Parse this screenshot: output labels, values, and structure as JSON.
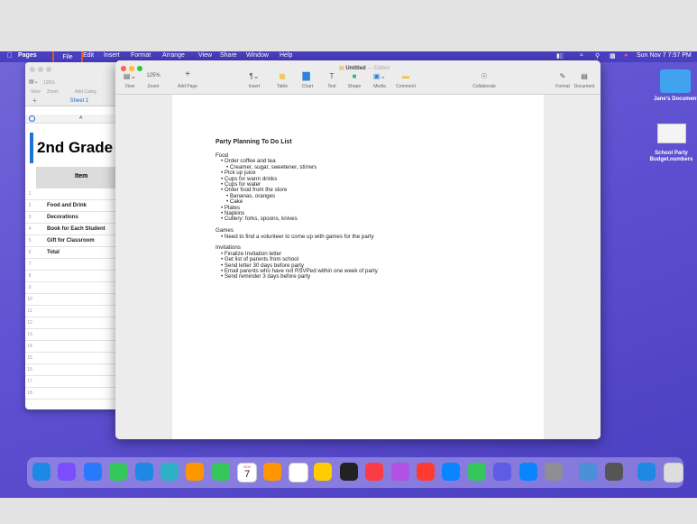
{
  "menubar": {
    "apple": "",
    "app": "Pages",
    "items": [
      "File",
      "Edit",
      "Insert",
      "Format",
      "Arrange",
      "View",
      "Share",
      "Window",
      "Help"
    ],
    "clock": "Sun Nov 7  7:57 PM"
  },
  "numbers_window": {
    "zoom": "125%",
    "toolbar_labels": [
      "View",
      "Zoom",
      "Add Categ"
    ],
    "sheet_tab": "Sheet 1",
    "column": "A",
    "title": "2nd Grade",
    "header": "Item",
    "rows": [
      {
        "num": "1",
        "text": ""
      },
      {
        "num": "2",
        "text": "Food  and Drink"
      },
      {
        "num": "3",
        "text": "Decorations"
      },
      {
        "num": "4",
        "text": "Book for Each Student"
      },
      {
        "num": "5",
        "text": "Gift for Classroom"
      },
      {
        "num": "6",
        "text": "Total"
      },
      {
        "num": "7",
        "text": ""
      },
      {
        "num": "8",
        "text": ""
      },
      {
        "num": "9",
        "text": ""
      },
      {
        "num": "10",
        "text": ""
      },
      {
        "num": "11",
        "text": ""
      },
      {
        "num": "12",
        "text": ""
      },
      {
        "num": "13",
        "text": ""
      },
      {
        "num": "14",
        "text": ""
      },
      {
        "num": "15",
        "text": ""
      },
      {
        "num": "16",
        "text": ""
      },
      {
        "num": "17",
        "text": ""
      },
      {
        "num": "18",
        "text": ""
      }
    ]
  },
  "pages_window": {
    "title": "Untitled",
    "title_suffix": "— Edited",
    "zoom": "125%",
    "toolbar": [
      "View",
      "Zoom",
      "Add Page",
      "Insert",
      "Table",
      "Chart",
      "Text",
      "Shape",
      "Media",
      "Comment",
      "Collaborate",
      "Format",
      "Document"
    ],
    "document": {
      "heading": "Party Planning To Do List",
      "lines": [
        {
          "t": "Food",
          "lvl": 0
        },
        {
          "t": "• Order coffee and tea",
          "lvl": 1
        },
        {
          "t": "• Creamer, sugar, sweetener, stirrers",
          "lvl": 2
        },
        {
          "t": "• Pick up juice",
          "lvl": 1
        },
        {
          "t": "• Cups for warm drinks",
          "lvl": 1
        },
        {
          "t": "• Cups for water",
          "lvl": 1
        },
        {
          "t": "• Order food from the store",
          "lvl": 1
        },
        {
          "t": "• Bananas, oranges",
          "lvl": 2
        },
        {
          "t": "• Cake",
          "lvl": 2
        },
        {
          "t": "• Plates",
          "lvl": 1
        },
        {
          "t": "• Napkins",
          "lvl": 1
        },
        {
          "t": "• Cutlery: forks, spoons, knives",
          "lvl": 1
        },
        {
          "t": "",
          "lvl": 0
        },
        {
          "t": "Games",
          "lvl": 0
        },
        {
          "t": "• Need to find a volunteer to come up with games for the party",
          "lvl": 1
        },
        {
          "t": "",
          "lvl": 0
        },
        {
          "t": "Invitations",
          "lvl": 0
        },
        {
          "t": "• Finalize Invitation letter",
          "lvl": 1
        },
        {
          "t": "• Get list of parents from school",
          "lvl": 1
        },
        {
          "t": "• Send letter 30 days before party",
          "lvl": 1
        },
        {
          "t": "• Email parents who have not RSVPed within one week of party",
          "lvl": 1
        },
        {
          "t": "• Send reminder 3 days before party",
          "lvl": 1
        }
      ]
    }
  },
  "desktop": {
    "folder": "Jane's Documents",
    "file": "School Party Budget.numbers"
  },
  "dock": {
    "calendar_month": "NOV",
    "calendar_day": "7",
    "colors": [
      "#1e88e5",
      "#7c4dff",
      "#2979ff",
      "#34c759",
      "#1e88e5",
      "#30b0c7",
      "#ff9500",
      "#34c759",
      "#ffffff",
      "#ff9500",
      "#ffffff",
      "#ffcc00",
      "#222222",
      "#fc3c44",
      "#b150e2",
      "#ff3b30",
      "#0a84ff",
      "#34c759",
      "#5e5ce6",
      "#0a84ff",
      "#8e8e93",
      "#4a90d9",
      "#555555",
      "#1e88e5",
      "#dddddd"
    ]
  }
}
